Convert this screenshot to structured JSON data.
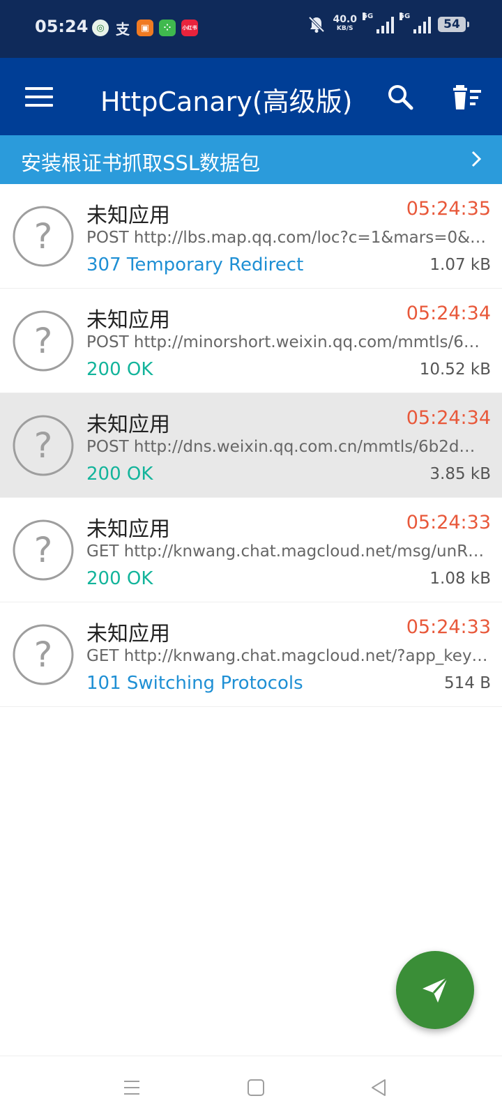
{
  "status_bar": {
    "time": "05:24",
    "net_speed_value": "40.0",
    "net_speed_unit": "KB/S",
    "network_1": "5G",
    "network_2": "5G",
    "battery": "54",
    "app_icons": [
      "bank-app-icon",
      "alipay-icon",
      "orange-app-icon",
      "green-app-icon",
      "red-app-icon"
    ],
    "alipay_glyph": "支",
    "red_app_label": "小红书"
  },
  "app_bar": {
    "title": "HttpCanary(高级版)"
  },
  "ssl_banner": {
    "text": "安装根证书抓取SSL数据包"
  },
  "requests": [
    {
      "app": "未知应用",
      "time": "05:24:35",
      "url": "POST http://lbs.map.qq.com/loc?c=1&mars=0&…",
      "status": "307 Temporary Redirect",
      "status_color": "#1e8fd4",
      "size": "1.07 kB",
      "selected": false
    },
    {
      "app": "未知应用",
      "time": "05:24:34",
      "url": "POST http://minorshort.weixin.qq.com/mmtls/6…",
      "status": "200 OK",
      "status_color": "#13b49b",
      "size": "10.52 kB",
      "selected": false
    },
    {
      "app": "未知应用",
      "time": "05:24:34",
      "url": "POST http://dns.weixin.qq.com.cn/mmtls/6b2d…",
      "status": "200 OK",
      "status_color": "#13b49b",
      "size": "3.85 kB",
      "selected": true
    },
    {
      "app": "未知应用",
      "time": "05:24:33",
      "url": "GET http://knwang.chat.magcloud.net/msg/unR…",
      "status": "200 OK",
      "status_color": "#13b49b",
      "size": "1.08 kB",
      "selected": false
    },
    {
      "app": "未知应用",
      "time": "05:24:33",
      "url": "GET http://knwang.chat.magcloud.net/?app_key…",
      "status": "101 Switching Protocols",
      "status_color": "#1e8fd4",
      "size": "514 B",
      "selected": false
    }
  ],
  "colors": {
    "status_bar": "#0f2a5a",
    "app_bar": "#003e96",
    "banner": "#2b9bdb",
    "time": "#e8583a",
    "fab": "#3a8e37"
  }
}
